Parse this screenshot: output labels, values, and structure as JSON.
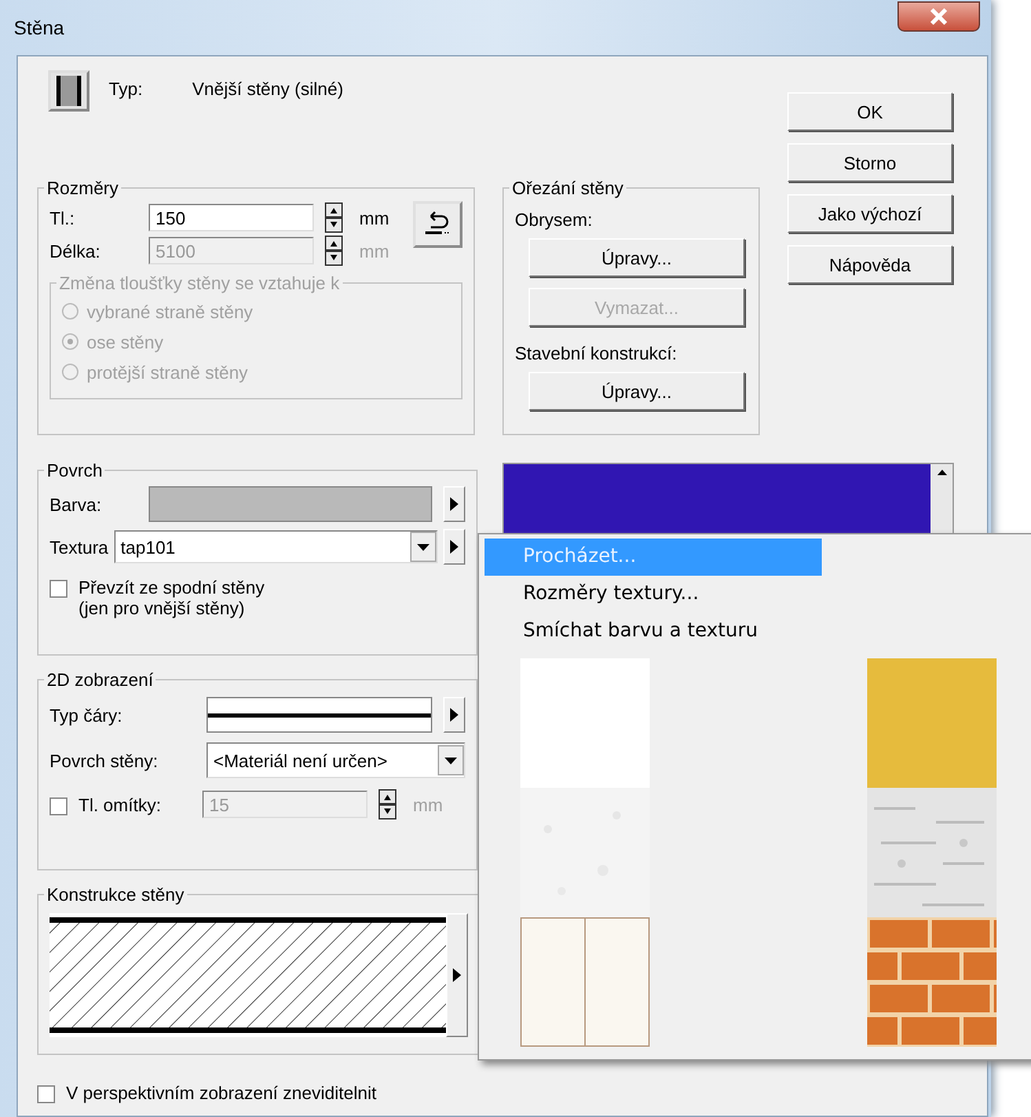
{
  "window": {
    "title": "Stěna"
  },
  "type": {
    "label": "Typ:",
    "value": "Vnější stěny (silné)"
  },
  "dimensions": {
    "title": "Rozměry",
    "fields": [
      {
        "label": "Tl.:",
        "value": "150",
        "unit": "mm",
        "disabled": false
      },
      {
        "label": "Délka:",
        "value": "5100",
        "unit": "mm",
        "disabled": true
      }
    ],
    "thickness_group": {
      "title": "Změna tloušťky stěny se vztahuje k",
      "disabled": true,
      "options": [
        {
          "label": "vybrané straně stěny",
          "selected": false
        },
        {
          "label": "ose stěny",
          "selected": true
        },
        {
          "label": "protější straně stěny",
          "selected": false
        }
      ]
    }
  },
  "trim": {
    "title": "Ořezání stěny",
    "items": [
      {
        "kind": "label",
        "text": "Obrysem:"
      },
      {
        "kind": "button",
        "text": "Úpravy...",
        "disabled": false
      },
      {
        "kind": "button",
        "text": "Vymazat...",
        "disabled": true
      },
      {
        "kind": "label",
        "text": "Stavební konstrukcí:"
      },
      {
        "kind": "button",
        "text": "Úpravy...",
        "disabled": false
      }
    ]
  },
  "buttons": [
    "OK",
    "Storno",
    "Jako výchozí",
    "Nápověda"
  ],
  "surface": {
    "title": "Povrch",
    "color_label": "Barva:",
    "texture_label": "Textura",
    "texture_value": "tap101",
    "inherit": {
      "lines": [
        "Převzít ze spodní stěny",
        "(jen pro vnější stěny)"
      ],
      "checked": false
    }
  },
  "view_2d": {
    "title": "2D zobrazení",
    "line_label": "Typ čáry:",
    "surface_label": "Povrch stěny:",
    "surface_value": "<Materiál není určen>",
    "plaster": {
      "label": "Tl. omítky:",
      "checked": false,
      "value": "15",
      "unit": "mm"
    }
  },
  "construction": {
    "title": "Konstrukce stěny"
  },
  "hide_in_perspective": {
    "label": "V perspektivním zobrazení zneviditelnit",
    "checked": false
  },
  "popup_menu": {
    "items": [
      {
        "label": "Procházet...",
        "selected": true
      },
      {
        "label": "Rozměry textury...",
        "selected": false
      },
      {
        "label": "Smíchat barvu a texturu",
        "selected": false
      }
    ],
    "textures": [
      {
        "kind": "plain"
      },
      {
        "kind": "ochre"
      },
      {
        "kind": "stucco"
      },
      {
        "kind": "plaster"
      },
      {
        "kind": "panel"
      },
      {
        "kind": "brick"
      }
    ]
  }
}
